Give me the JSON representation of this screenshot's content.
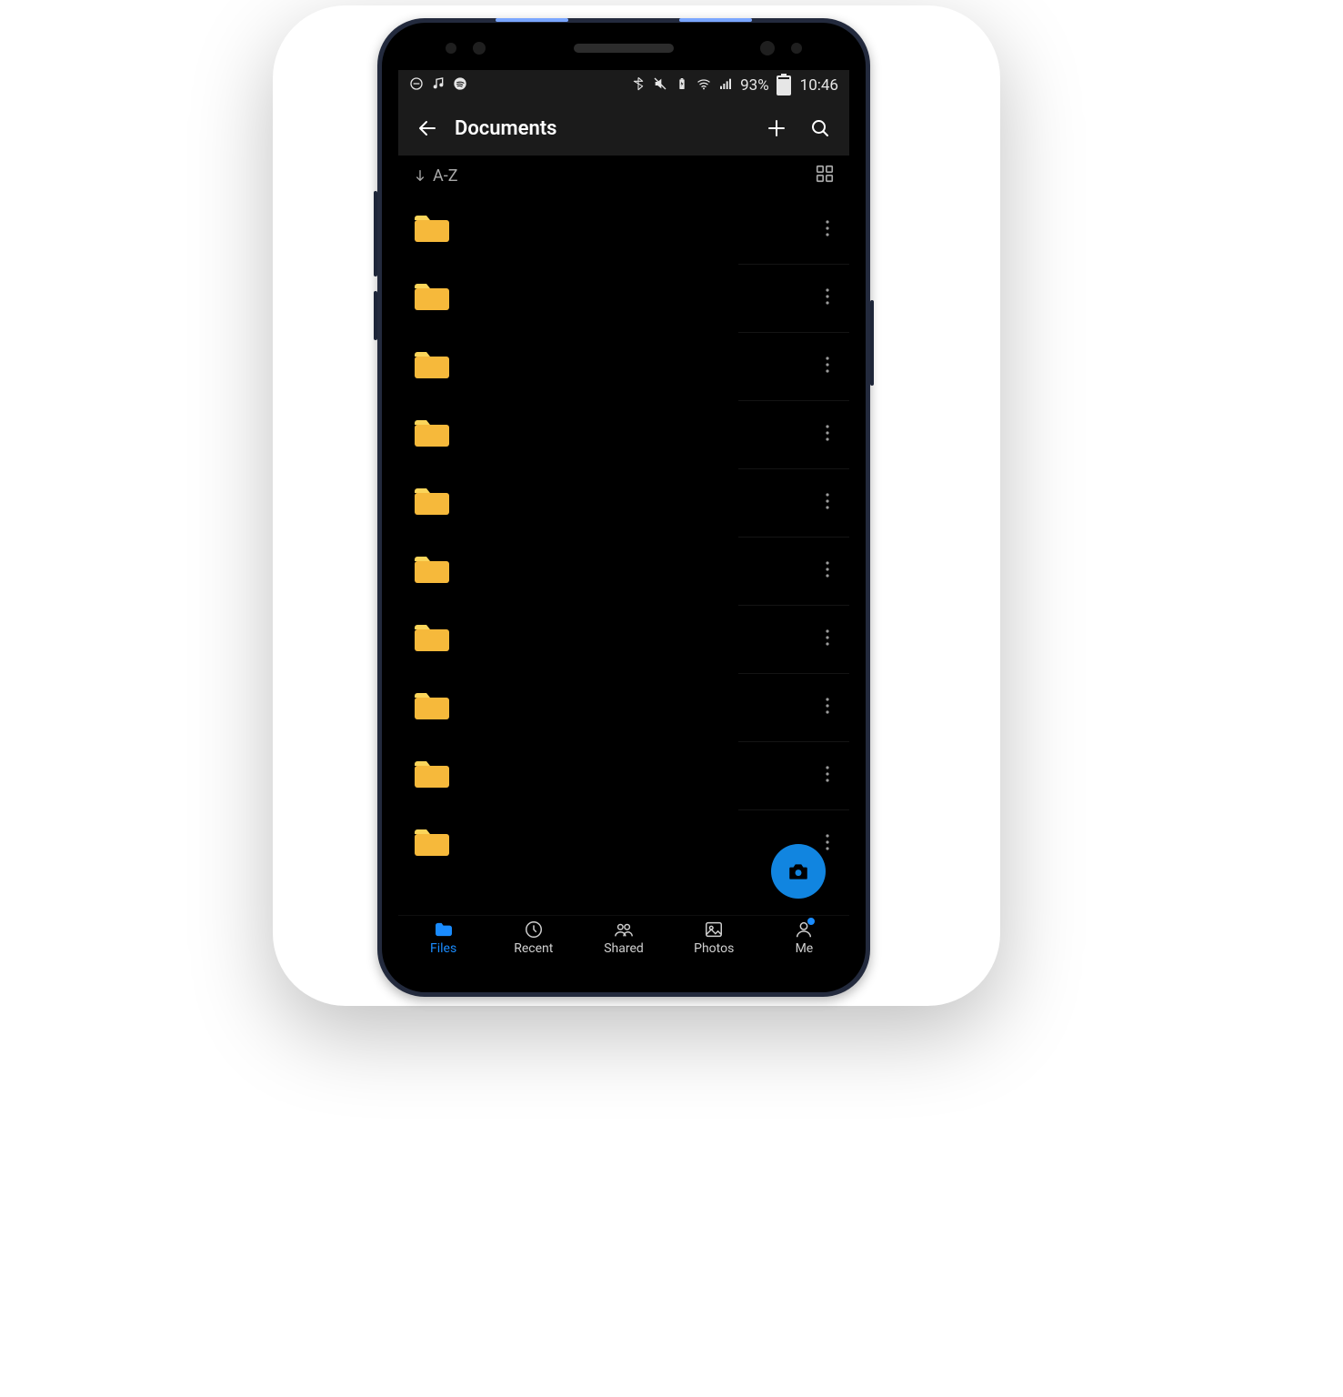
{
  "status": {
    "battery": "93%",
    "time": "10:46"
  },
  "header": {
    "title": "Documents"
  },
  "sort": {
    "label": "A-Z"
  },
  "folders": [
    {
      "name": ""
    },
    {
      "name": ""
    },
    {
      "name": ""
    },
    {
      "name": ""
    },
    {
      "name": ""
    },
    {
      "name": ""
    },
    {
      "name": ""
    },
    {
      "name": ""
    },
    {
      "name": ""
    },
    {
      "name": ""
    }
  ],
  "tabs": {
    "files": "Files",
    "recent": "Recent",
    "shared": "Shared",
    "photos": "Photos",
    "me": "Me"
  },
  "colors": {
    "accent": "#1a8cff",
    "folder_top": "#fbd55a",
    "folder_bot": "#f6b93b"
  }
}
